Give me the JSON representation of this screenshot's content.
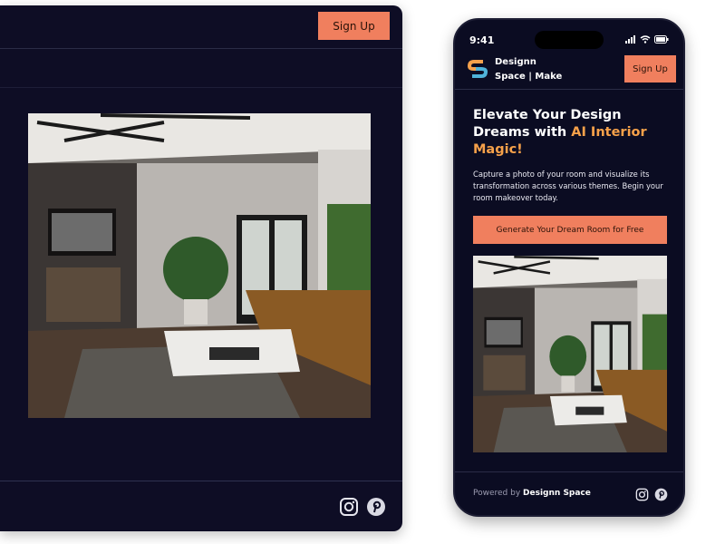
{
  "desktop": {
    "signup_label": "Sign Up",
    "image": "room-photo",
    "footer_icons": [
      "instagram-icon",
      "pinterest-icon"
    ]
  },
  "phone": {
    "status_time": "9:41",
    "brand_line1": "Designn",
    "brand_line2": "Space | Make",
    "signup_label": "Sign Up",
    "headline_part1": "Elevate Your Design Dreams with ",
    "headline_accent": "AI Interior Magic!",
    "description": "Capture a photo of your room and visualize its transformation across various themes. Begin your room makeover today.",
    "cta_label": "Generate Your Dream Room for Free",
    "footer_prefix": "Powered by ",
    "footer_brand": "Designn Space",
    "footer_icons": [
      "instagram-icon",
      "pinterest-icon"
    ]
  },
  "colors": {
    "background": "#0e0d25",
    "accent_button": "#f07f5e",
    "headline_accent": "#f6a14a"
  }
}
